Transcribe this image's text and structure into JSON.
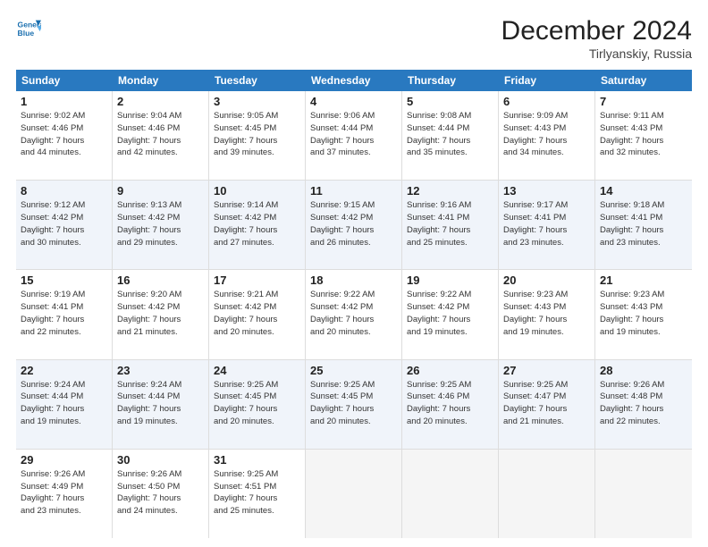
{
  "logo": {
    "line1": "General",
    "line2": "Blue"
  },
  "title": "December 2024",
  "subtitle": "Tirlyanskiy, Russia",
  "header_days": [
    "Sunday",
    "Monday",
    "Tuesday",
    "Wednesday",
    "Thursday",
    "Friday",
    "Saturday"
  ],
  "weeks": [
    [
      {
        "day": "1",
        "l1": "Sunrise: 9:02 AM",
        "l2": "Sunset: 4:46 PM",
        "l3": "Daylight: 7 hours",
        "l4": "and 44 minutes."
      },
      {
        "day": "2",
        "l1": "Sunrise: 9:04 AM",
        "l2": "Sunset: 4:46 PM",
        "l3": "Daylight: 7 hours",
        "l4": "and 42 minutes."
      },
      {
        "day": "3",
        "l1": "Sunrise: 9:05 AM",
        "l2": "Sunset: 4:45 PM",
        "l3": "Daylight: 7 hours",
        "l4": "and 39 minutes."
      },
      {
        "day": "4",
        "l1": "Sunrise: 9:06 AM",
        "l2": "Sunset: 4:44 PM",
        "l3": "Daylight: 7 hours",
        "l4": "and 37 minutes."
      },
      {
        "day": "5",
        "l1": "Sunrise: 9:08 AM",
        "l2": "Sunset: 4:44 PM",
        "l3": "Daylight: 7 hours",
        "l4": "and 35 minutes."
      },
      {
        "day": "6",
        "l1": "Sunrise: 9:09 AM",
        "l2": "Sunset: 4:43 PM",
        "l3": "Daylight: 7 hours",
        "l4": "and 34 minutes."
      },
      {
        "day": "7",
        "l1": "Sunrise: 9:11 AM",
        "l2": "Sunset: 4:43 PM",
        "l3": "Daylight: 7 hours",
        "l4": "and 32 minutes."
      }
    ],
    [
      {
        "day": "8",
        "l1": "Sunrise: 9:12 AM",
        "l2": "Sunset: 4:42 PM",
        "l3": "Daylight: 7 hours",
        "l4": "and 30 minutes."
      },
      {
        "day": "9",
        "l1": "Sunrise: 9:13 AM",
        "l2": "Sunset: 4:42 PM",
        "l3": "Daylight: 7 hours",
        "l4": "and 29 minutes."
      },
      {
        "day": "10",
        "l1": "Sunrise: 9:14 AM",
        "l2": "Sunset: 4:42 PM",
        "l3": "Daylight: 7 hours",
        "l4": "and 27 minutes."
      },
      {
        "day": "11",
        "l1": "Sunrise: 9:15 AM",
        "l2": "Sunset: 4:42 PM",
        "l3": "Daylight: 7 hours",
        "l4": "and 26 minutes."
      },
      {
        "day": "12",
        "l1": "Sunrise: 9:16 AM",
        "l2": "Sunset: 4:41 PM",
        "l3": "Daylight: 7 hours",
        "l4": "and 25 minutes."
      },
      {
        "day": "13",
        "l1": "Sunrise: 9:17 AM",
        "l2": "Sunset: 4:41 PM",
        "l3": "Daylight: 7 hours",
        "l4": "and 23 minutes."
      },
      {
        "day": "14",
        "l1": "Sunrise: 9:18 AM",
        "l2": "Sunset: 4:41 PM",
        "l3": "Daylight: 7 hours",
        "l4": "and 23 minutes."
      }
    ],
    [
      {
        "day": "15",
        "l1": "Sunrise: 9:19 AM",
        "l2": "Sunset: 4:41 PM",
        "l3": "Daylight: 7 hours",
        "l4": "and 22 minutes."
      },
      {
        "day": "16",
        "l1": "Sunrise: 9:20 AM",
        "l2": "Sunset: 4:42 PM",
        "l3": "Daylight: 7 hours",
        "l4": "and 21 minutes."
      },
      {
        "day": "17",
        "l1": "Sunrise: 9:21 AM",
        "l2": "Sunset: 4:42 PM",
        "l3": "Daylight: 7 hours",
        "l4": "and 20 minutes."
      },
      {
        "day": "18",
        "l1": "Sunrise: 9:22 AM",
        "l2": "Sunset: 4:42 PM",
        "l3": "Daylight: 7 hours",
        "l4": "and 20 minutes."
      },
      {
        "day": "19",
        "l1": "Sunrise: 9:22 AM",
        "l2": "Sunset: 4:42 PM",
        "l3": "Daylight: 7 hours",
        "l4": "and 19 minutes."
      },
      {
        "day": "20",
        "l1": "Sunrise: 9:23 AM",
        "l2": "Sunset: 4:43 PM",
        "l3": "Daylight: 7 hours",
        "l4": "and 19 minutes."
      },
      {
        "day": "21",
        "l1": "Sunrise: 9:23 AM",
        "l2": "Sunset: 4:43 PM",
        "l3": "Daylight: 7 hours",
        "l4": "and 19 minutes."
      }
    ],
    [
      {
        "day": "22",
        "l1": "Sunrise: 9:24 AM",
        "l2": "Sunset: 4:44 PM",
        "l3": "Daylight: 7 hours",
        "l4": "and 19 minutes."
      },
      {
        "day": "23",
        "l1": "Sunrise: 9:24 AM",
        "l2": "Sunset: 4:44 PM",
        "l3": "Daylight: 7 hours",
        "l4": "and 19 minutes."
      },
      {
        "day": "24",
        "l1": "Sunrise: 9:25 AM",
        "l2": "Sunset: 4:45 PM",
        "l3": "Daylight: 7 hours",
        "l4": "and 20 minutes."
      },
      {
        "day": "25",
        "l1": "Sunrise: 9:25 AM",
        "l2": "Sunset: 4:45 PM",
        "l3": "Daylight: 7 hours",
        "l4": "and 20 minutes."
      },
      {
        "day": "26",
        "l1": "Sunrise: 9:25 AM",
        "l2": "Sunset: 4:46 PM",
        "l3": "Daylight: 7 hours",
        "l4": "and 20 minutes."
      },
      {
        "day": "27",
        "l1": "Sunrise: 9:25 AM",
        "l2": "Sunset: 4:47 PM",
        "l3": "Daylight: 7 hours",
        "l4": "and 21 minutes."
      },
      {
        "day": "28",
        "l1": "Sunrise: 9:26 AM",
        "l2": "Sunset: 4:48 PM",
        "l3": "Daylight: 7 hours",
        "l4": "and 22 minutes."
      }
    ],
    [
      {
        "day": "29",
        "l1": "Sunrise: 9:26 AM",
        "l2": "Sunset: 4:49 PM",
        "l3": "Daylight: 7 hours",
        "l4": "and 23 minutes."
      },
      {
        "day": "30",
        "l1": "Sunrise: 9:26 AM",
        "l2": "Sunset: 4:50 PM",
        "l3": "Daylight: 7 hours",
        "l4": "and 24 minutes."
      },
      {
        "day": "31",
        "l1": "Sunrise: 9:25 AM",
        "l2": "Sunset: 4:51 PM",
        "l3": "Daylight: 7 hours",
        "l4": "and 25 minutes."
      },
      null,
      null,
      null,
      null
    ]
  ]
}
